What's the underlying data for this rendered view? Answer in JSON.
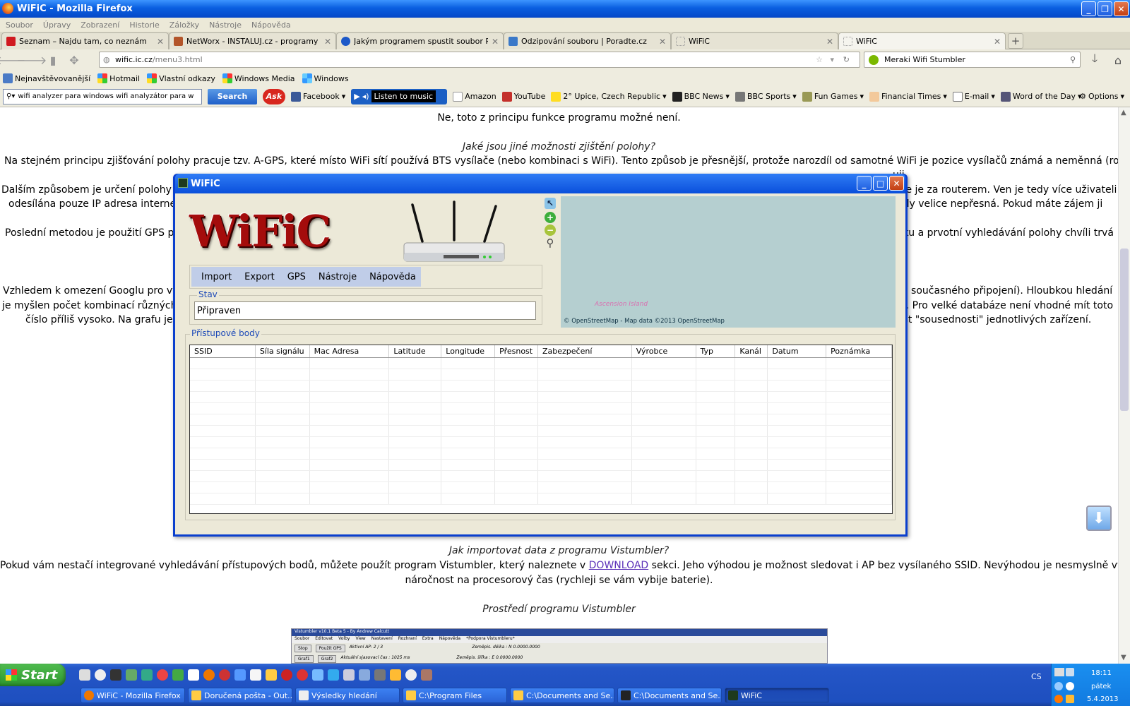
{
  "browser": {
    "window_title": "WiFiC - Mozilla Firefox",
    "menu": [
      "Soubor",
      "Úpravy",
      "Zobrazení",
      "Historie",
      "Záložky",
      "Nástroje",
      "Nápověda"
    ],
    "tabs": [
      {
        "label": "Seznam – Najdu tam, co neznám",
        "icon_color": "#d0191f"
      },
      {
        "label": "NetWorx - INSTALUJ.cz - programy ke st...",
        "icon_color": "#b3552a"
      },
      {
        "label": "Jakým programem spustit soubor RAR - J...",
        "icon_color": "#1c58c8"
      },
      {
        "label": "Odzipování souboru | Poradte.cz",
        "icon_color": "#3a78c8"
      },
      {
        "label": "WiFiC",
        "icon_color": "#cccccc"
      },
      {
        "label": "WiFiC",
        "icon_color": "#cccccc",
        "active": true
      }
    ],
    "url_domain": "wific.ic.cz",
    "url_path": "/menu3.html",
    "search_value": "Meraki Wifi Stumbler",
    "bookmarks": [
      "Nejnavštěvovanější",
      "Hotmail",
      "Vlastní odkazy",
      "Windows Media",
      "Windows"
    ],
    "toolbar": {
      "search_value": "wifi analyzer para windows wifi analyzátor para w",
      "search_button": "Search",
      "ask": "Ask",
      "facebook": "Facebook",
      "music": "Listen to music",
      "items": [
        "Amazon",
        "YouTube",
        "2° Upice, Czech Republic",
        "BBC News",
        "BBC Sports",
        "Fun Games",
        "Financial Times",
        "E-mail",
        "Word of the Day"
      ],
      "options": "Options"
    }
  },
  "page": {
    "line0": "Ne, toto z principu funkce programu možné není.",
    "heading1": "Jaké jsou jiné možnosti zjištění polohy?",
    "p1a_left": "Na stejném principu zjišťování polohy pracuje tzv. A-GPS, které místo WiFi sítí používá BTS vysílače (nebo kombinaci s WiFi). Tento způsob je přesnější, protože narozdíl od samotné WiFi je pozice vysílačů známá a neměnná (router",
    "p1b_right": "uji.",
    "p2a_left": "Dalším způsobem je určení polohy p",
    "p2a_right": "ale je za routerem. Ven je tedy více uživateli",
    "p2b_left": "odesílána pouze IP adresa interne",
    "p2b_right": "edy velice nepřesná. Pokud máte zájem ji",
    "p3_left": "Poslední metodou je použití GPS pi",
    "p3_right": "aku a prvotní vyhledávání polohy chvíli trvá",
    "p4a_left": "Vzhledem k omezení Googlu pro vy",
    "p4a_right": "sy současného připojení). Hloubkou hledání",
    "p4b_left": "je myšlen počet kombinací různých",
    "p4b_right": "ní. Pro velké databáze není vhodné mít toto",
    "p4c_left": "číslo příliš vysoko. Na grafu je v",
    "p4c_right": "ost \"sousednosti\" jednotlivých zařízení.",
    "heading2": "Jak importovat data z programu Vistumbler?",
    "p5a_pre": "Pokud vám nestačí integrované vyhledávání přístupových bodů, můžete použít program Vistumbler, který naleznete v ",
    "p5a_link": "DOWNLOAD",
    "p5a_post": " sekci. Jeho výhodou je možnost sledovat i AP bez vysílaného SSID. Nevýhodou je nesmyslně vysoká",
    "p5b": "náročnost na procesorový čas (rychleji se vám vybije baterie).",
    "heading3": "Prostředí programu Vistumbler",
    "vistumbler_title": "Vistumbler v10.1 Beta 5 - By Andrew Calcutt",
    "vistumbler_menu": [
      "Soubor",
      "Editovat",
      "Volby",
      "View",
      "Nastavení",
      "Rozhraní",
      "Extra",
      "Nápověda",
      "*Podpora Vistumbleru*"
    ],
    "vistumbler_buttons": [
      "Stop",
      "Použít GPS",
      "Graf1",
      "Graf2"
    ],
    "vistumbler_info": [
      "Aktivní AP: 2 / 3",
      "Aktuální sjasovací čas : 1025 ms",
      "Zeměpis. délka : N 0.0000.0000",
      "Zeměpis. šířka : E 0.0000.0000"
    ]
  },
  "wific": {
    "title": "WiFiC",
    "logo_text": "WiFiC",
    "menu": [
      "Import",
      "Export",
      "GPS",
      "Nástroje",
      "Nápověda"
    ],
    "status_legend": "Stav",
    "status_value": "Připraven",
    "map_label": "Ascension Island",
    "map_attribution": "© OpenStreetMap - Map data ©2013 OpenStreetMap",
    "ap_legend": "Přístupové body",
    "columns": [
      "SSID",
      "Síla signálu",
      "Mac Adresa",
      "Latitude",
      "Longitude",
      "Přesnost",
      "Zabezpečení",
      "Výrobce",
      "Typ",
      "Kanál",
      "Datum",
      "Poznámka"
    ]
  },
  "taskbar": {
    "start": "Start",
    "tasks": [
      "WiFiC - Mozilla Firefox",
      "Doručená pošta - Out...",
      "Výsledky hledání",
      "C:\\Program Files",
      "C:\\Documents and Se...",
      "C:\\Documents and Se...",
      "WiFiC"
    ],
    "lang": "CS",
    "time": "18:11",
    "day": "pátek",
    "date": "5.4.2013"
  }
}
